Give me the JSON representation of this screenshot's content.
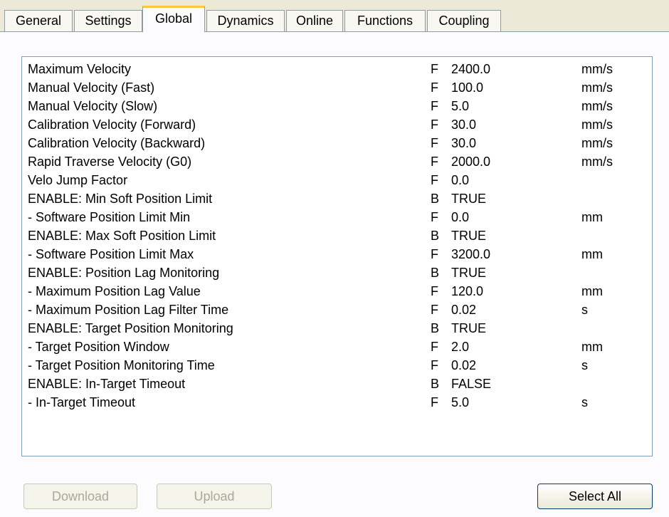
{
  "tabs": [
    {
      "label": "General"
    },
    {
      "label": "Settings"
    },
    {
      "label": "Global"
    },
    {
      "label": "Dynamics"
    },
    {
      "label": "Online"
    },
    {
      "label": "Functions"
    },
    {
      "label": "Coupling"
    }
  ],
  "active_tab": "Global",
  "parameters": [
    {
      "name": "Maximum Velocity",
      "type": "F",
      "value": "2400.0",
      "unit": "mm/s"
    },
    {
      "name": "Manual Velocity (Fast)",
      "type": "F",
      "value": "100.0",
      "unit": "mm/s"
    },
    {
      "name": "Manual Velocity (Slow)",
      "type": "F",
      "value": "5.0",
      "unit": "mm/s"
    },
    {
      "name": "Calibration Velocity (Forward)",
      "type": "F",
      "value": "30.0",
      "unit": "mm/s"
    },
    {
      "name": "Calibration Velocity (Backward)",
      "type": "F",
      "value": "30.0",
      "unit": "mm/s"
    },
    {
      "name": "Rapid Traverse Velocity (G0)",
      "type": "F",
      "value": "2000.0",
      "unit": "mm/s"
    },
    {
      "name": "Velo Jump Factor",
      "type": "F",
      "value": "0.0",
      "unit": ""
    },
    {
      "name": "ENABLE: Min Soft Position Limit",
      "type": "B",
      "value": "TRUE",
      "unit": ""
    },
    {
      "name": " - Software Position Limit Min",
      "type": "F",
      "value": "0.0",
      "unit": "mm"
    },
    {
      "name": "ENABLE: Max Soft Position Limit",
      "type": "B",
      "value": "TRUE",
      "unit": ""
    },
    {
      "name": " - Software Position Limit Max",
      "type": "F",
      "value": "3200.0",
      "unit": "mm"
    },
    {
      "name": "ENABLE: Position Lag Monitoring",
      "type": "B",
      "value": "TRUE",
      "unit": ""
    },
    {
      "name": " - Maximum Position Lag Value",
      "type": "F",
      "value": "120.0",
      "unit": "mm"
    },
    {
      "name": " - Maximum Position Lag Filter Time",
      "type": "F",
      "value": "0.02",
      "unit": "s"
    },
    {
      "name": "ENABLE: Target Position Monitoring",
      "type": "B",
      "value": "TRUE",
      "unit": ""
    },
    {
      "name": " - Target Position Window",
      "type": "F",
      "value": "2.0",
      "unit": "mm"
    },
    {
      "name": " - Target Position Monitoring Time",
      "type": "F",
      "value": "0.02",
      "unit": "s"
    },
    {
      "name": "ENABLE: In-Target Timeout",
      "type": "B",
      "value": "FALSE",
      "unit": ""
    },
    {
      "name": " - In-Target Timeout",
      "type": "F",
      "value": "5.0",
      "unit": "s"
    }
  ],
  "buttons": {
    "download_label": "Download",
    "upload_label": "Upload",
    "select_all_label": "Select All"
  }
}
